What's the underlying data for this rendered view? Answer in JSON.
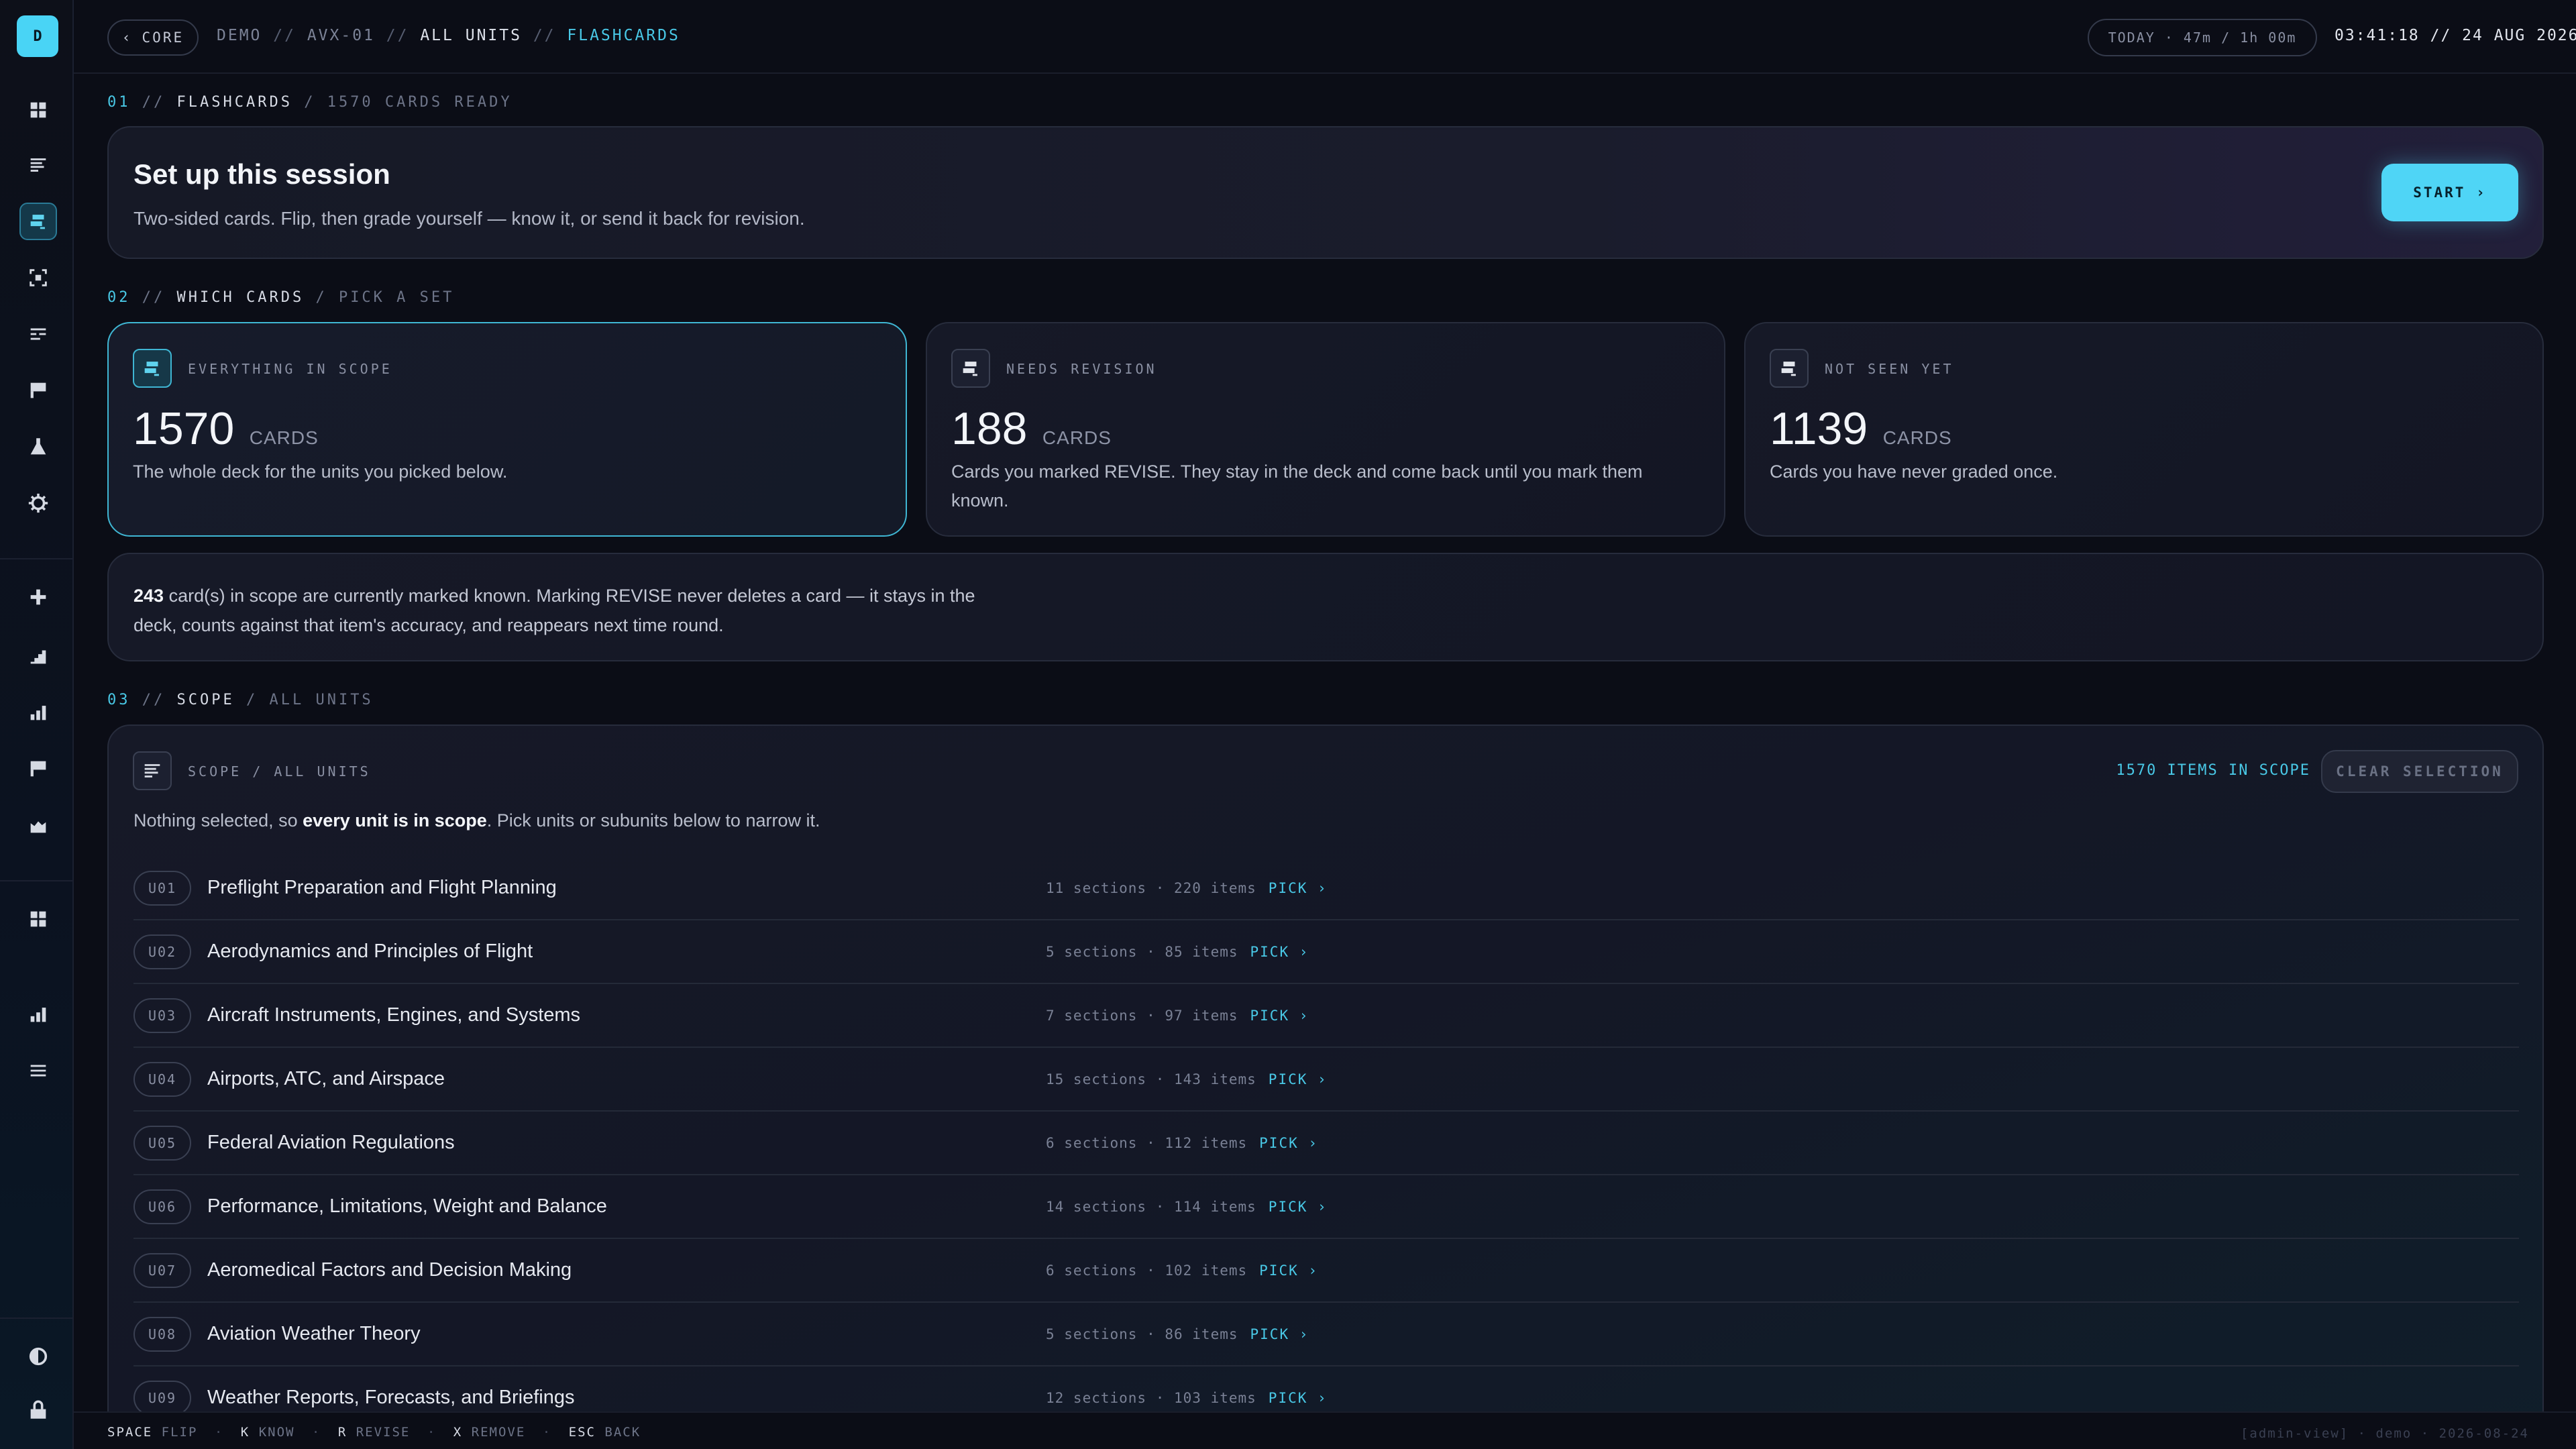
{
  "app": {
    "logo_letter": "D",
    "accent": "#49d4f5"
  },
  "sidebar": {
    "items": [
      {
        "icon": "grid-icon"
      },
      {
        "icon": "list-icon"
      },
      {
        "icon": "flashcards-icon",
        "active": true
      },
      {
        "icon": "focus-icon"
      },
      {
        "icon": "outline-icon"
      },
      {
        "icon": "flag-icon"
      },
      {
        "icon": "flask-icon"
      },
      {
        "icon": "gear-icon"
      },
      {
        "icon": "plus-icon"
      },
      {
        "icon": "stairs-chart-icon"
      },
      {
        "icon": "bar-chart-icon"
      },
      {
        "icon": "flag-icon"
      },
      {
        "icon": "area-chart-icon"
      },
      {
        "icon": "grid-icon"
      },
      {
        "icon": "bar-chart-icon"
      },
      {
        "icon": "menu-icon"
      },
      {
        "icon": "contrast-icon"
      },
      {
        "icon": "lock-icon"
      }
    ]
  },
  "topbar": {
    "back_label": "CORE",
    "breadcrumb": {
      "part1": "DEMO",
      "part2": "AVX-01",
      "part3": "ALL UNITS",
      "part4": "FLASHCARDS",
      "sep": "//"
    },
    "today": "TODAY · 47m / 1h 00m",
    "clock": "03:41:18 // 24 AUG 2026"
  },
  "sections": {
    "s1": {
      "num": "01",
      "sep": "//",
      "title": "FLASHCARDS",
      "sub": "/ 1570 CARDS READY"
    },
    "s2": {
      "num": "02",
      "sep": "//",
      "title": "WHICH CARDS",
      "sub": "/ PICK A SET"
    },
    "s3": {
      "num": "03",
      "sep": "//",
      "title": "SCOPE",
      "sub": "/ ALL UNITS"
    }
  },
  "setup": {
    "title": "Set up this session",
    "desc": "Two-sided cards. Flip, then grade yourself — know it, or send it back for revision.",
    "start_label": "START ›"
  },
  "pick_cards": [
    {
      "label": "EVERYTHING IN SCOPE",
      "count": "1570",
      "unit": "CARDS",
      "desc": "The whole deck for the units you picked below."
    },
    {
      "label": "NEEDS REVISION",
      "count": "188",
      "unit": "CARDS",
      "desc": "Cards you marked REVISE. They stay in the deck and come back until you mark them known."
    },
    {
      "label": "NOT SEEN YET",
      "count": "1139",
      "unit": "CARDS",
      "desc": "Cards you have never graded once."
    }
  ],
  "info": {
    "known_count": "243",
    "text": " card(s) in scope are currently marked known. Marking REVISE never deletes a card — it stays in the deck, counts against that item's accuracy, and reappears next time round."
  },
  "scope": {
    "label": "SCOPE / ALL UNITS",
    "items_in_scope": "1570 ITEMS IN SCOPE",
    "clear_label": "CLEAR SELECTION",
    "note_pre": "Nothing selected, so ",
    "note_bold": "every unit is in scope",
    "note_post": ". Pick units or subunits below to narrow it.",
    "units": [
      {
        "code": "U01",
        "name": "Preflight Preparation and Flight Planning",
        "meta": "11 sections · 220 items",
        "pick": "PICK ›"
      },
      {
        "code": "U02",
        "name": "Aerodynamics and Principles of Flight",
        "meta": "5 sections · 85 items",
        "pick": "PICK ›"
      },
      {
        "code": "U03",
        "name": "Aircraft Instruments, Engines, and Systems",
        "meta": "7 sections · 97 items",
        "pick": "PICK ›"
      },
      {
        "code": "U04",
        "name": "Airports, ATC, and Airspace",
        "meta": "15 sections · 143 items",
        "pick": "PICK ›"
      },
      {
        "code": "U05",
        "name": "Federal Aviation Regulations",
        "meta": "6 sections · 112 items",
        "pick": "PICK ›"
      },
      {
        "code": "U06",
        "name": "Performance, Limitations, Weight and Balance",
        "meta": "14 sections · 114 items",
        "pick": "PICK ›"
      },
      {
        "code": "U07",
        "name": "Aeromedical Factors and Decision Making",
        "meta": "6 sections · 102 items",
        "pick": "PICK ›"
      },
      {
        "code": "U08",
        "name": "Aviation Weather Theory",
        "meta": "5 sections · 86 items",
        "pick": "PICK ›"
      },
      {
        "code": "U09",
        "name": "Weather Reports, Forecasts, and Briefings",
        "meta": "12 sections · 103 items",
        "pick": "PICK ›"
      }
    ]
  },
  "shortcuts": {
    "items": [
      {
        "key": "SPACE",
        "action": "FLIP"
      },
      {
        "key": "K",
        "action": "KNOW"
      },
      {
        "key": "R",
        "action": "REVISE"
      },
      {
        "key": "X",
        "action": "REMOVE"
      },
      {
        "key": "ESC",
        "action": "BACK"
      }
    ],
    "footer": "[admin-view] · demo · 2026-08-24"
  }
}
